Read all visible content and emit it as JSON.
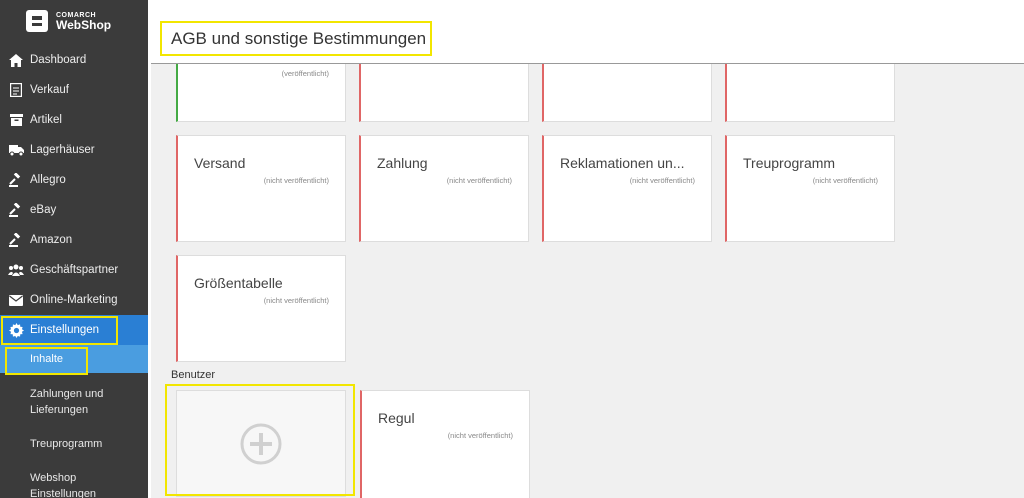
{
  "brand": {
    "top": "COMARCH",
    "name": "WebShop"
  },
  "sidebar": {
    "items": [
      {
        "label": "Dashboard",
        "icon": "home-icon"
      },
      {
        "label": "Verkauf",
        "icon": "document-icon"
      },
      {
        "label": "Artikel",
        "icon": "box-icon"
      },
      {
        "label": "Lagerhäuser",
        "icon": "truck-icon"
      },
      {
        "label": "Allegro",
        "icon": "gavel-icon"
      },
      {
        "label": "eBay",
        "icon": "gavel-icon"
      },
      {
        "label": "Amazon",
        "icon": "gavel-icon"
      },
      {
        "label": "Geschäftspartner",
        "icon": "users-icon"
      },
      {
        "label": "Online-Marketing",
        "icon": "envelope-icon"
      },
      {
        "label": "Einstellungen",
        "icon": "gear-icon"
      }
    ],
    "subitems": [
      {
        "label": "Inhalte"
      },
      {
        "label": "Zahlungen und Lieferungen"
      },
      {
        "label": "Treuprogramm"
      },
      {
        "label": "Webshop Einstellungen"
      }
    ]
  },
  "page": {
    "title": "AGB und sonstige Bestimmungen"
  },
  "cards_top_row": {
    "status": "(veröffentlicht)"
  },
  "cards": [
    {
      "title": "Versand",
      "status": "(nicht veröffentlicht)"
    },
    {
      "title": "Zahlung",
      "status": "(nicht veröffentlicht)"
    },
    {
      "title": "Reklamationen un...",
      "status": "(nicht veröffentlicht)"
    },
    {
      "title": "Treuprogramm",
      "status": "(nicht veröffentlicht)"
    },
    {
      "title": "Größentabelle",
      "status": "(nicht veröffentlicht)"
    }
  ],
  "benutzer": {
    "label": "Benutzer",
    "cards": [
      {
        "title": "Regul",
        "status": "(nicht veröffentlicht)"
      }
    ]
  },
  "colors": {
    "sidebar_bg": "#3b3b3b",
    "active": "#2a7fd4",
    "active_sub": "#4a9de0",
    "highlight": "#f2e600",
    "unpublished": "#e06666",
    "published": "#44aa44"
  }
}
